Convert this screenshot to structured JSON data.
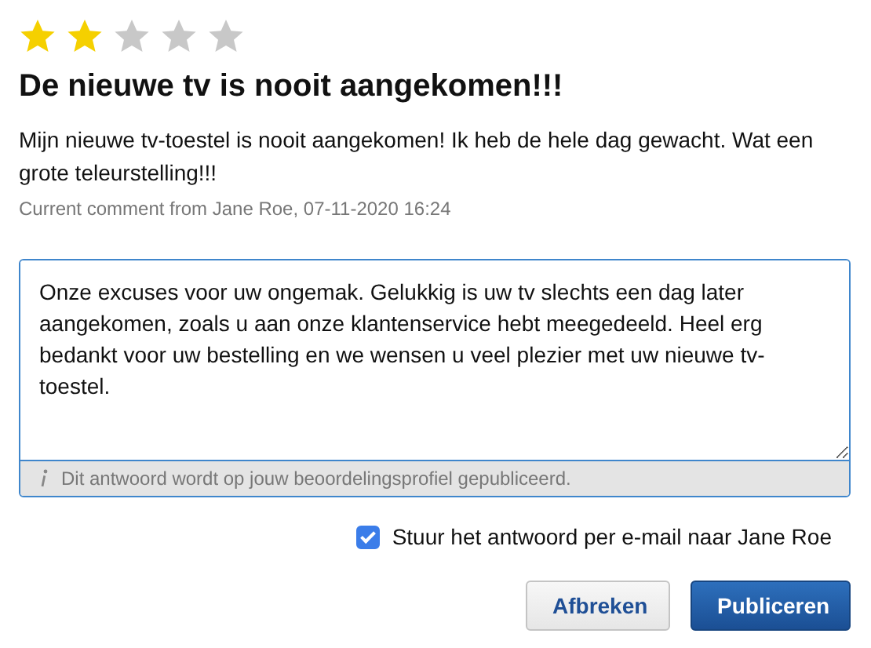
{
  "review": {
    "stars": 2,
    "title": "De nieuwe tv is nooit aangekomen!!!",
    "body": "Mijn nieuwe tv-toestel is nooit aangekomen! Ik heb de hele dag gewacht. Wat een grote teleurstelling!!!",
    "meta": "Current comment from Jane Roe, 07-11-2020 16:24"
  },
  "reply": {
    "value": "Onze excuses voor uw ongemak. Gelukkig is uw tv slechts een dag later aangekomen, zoals u aan onze klantenservice hebt meegedeeld. Heel erg bedankt voor uw bestelling en we wensen u veel plezier met uw nieuwe tv-toestel.",
    "hint": "Dit antwoord wordt op jouw beoordelingsprofiel gepubliceerd."
  },
  "email_option": {
    "label": "Stuur het antwoord per e-mail naar Jane Roe",
    "checked": true
  },
  "buttons": [
    {
      "label": "Afbreken",
      "kind": "secondary"
    },
    {
      "label": "Publiceren",
      "kind": "primary"
    }
  ]
}
